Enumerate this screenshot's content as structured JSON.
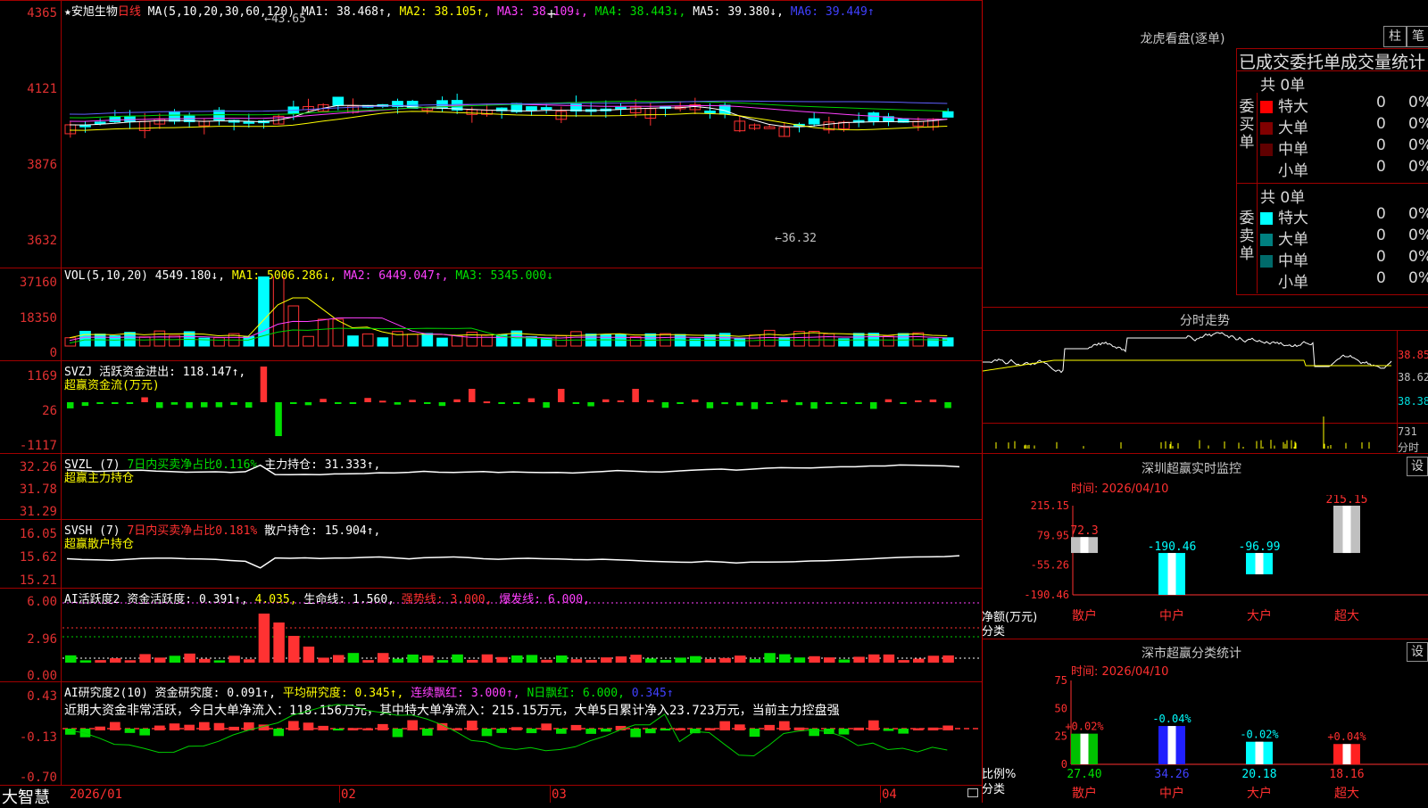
{
  "colors": {
    "up": "#ff3232",
    "down": "#00ffff",
    "grid": "#a00000",
    "ma1": "#ffffff",
    "ma2": "#ffff00",
    "ma3": "#ff40ff",
    "ma4": "#00d000",
    "ma5": "#8080ff"
  },
  "stock": {
    "name": "★安旭生物",
    "period": "日线"
  },
  "price_panel": {
    "ma_title": "MA(5,10,20,30,60,120)",
    "ma1": "MA1: 38.468↑,",
    "ma2": "MA2: 38.105↑,",
    "ma3": "MA3: 38.109↓,",
    "ma4": "MA4: 38.443↓,",
    "ma5": "MA5: 39.380↓,",
    "ma6": "MA6: 39.449↑",
    "y_ticks": [
      "4365",
      "4121",
      "3876",
      "3632"
    ],
    "high_label": "←43.65",
    "low_label": "←36.32",
    "cross": "+"
  },
  "vol_panel": {
    "title": "VOL(5,10,20)",
    "value": "4549.180↓,",
    "ma1": "MA1: 5006.286↓,",
    "ma2": "MA2: 6449.047↑,",
    "ma3": "MA3: 5345.000↓",
    "y_ticks": [
      "37160",
      "18350",
      "0"
    ]
  },
  "svzj_panel": {
    "title": "SVZJ  活跃资金进出: 118.147↑,",
    "sub": "超赢资金流(万元)",
    "y_ticks": [
      "1169",
      "26",
      "-1117"
    ]
  },
  "svzl_panel": {
    "title": "SVZL (7)",
    "ratio": "7日内买卖净占比0.116%",
    "hold": "主力持仓: 31.333↑,",
    "sub": "超赢主力持仓",
    "y_ticks": [
      "32.26",
      "31.78",
      "31.29"
    ]
  },
  "svsh_panel": {
    "title": "SVSH (7)",
    "ratio": "7日内买卖净占比0.181%",
    "hold": "散户持仓: 15.904↑,",
    "sub": "超赢散户持仓",
    "y_ticks": [
      "16.05",
      "15.62",
      "15.21"
    ]
  },
  "ai1_panel": {
    "title": "AI活跃度2 资金活跃度: 0.391↑,",
    "v2": "4.035,",
    "life": "生命线: 1.560,",
    "strong": "强势线: 3.000,",
    "burst": "爆发线: 6.000,",
    "y_ticks": [
      "6.00",
      "2.96",
      "0.00"
    ]
  },
  "ai2_panel": {
    "title": "AI研究度2(10) 资金研究度: 0.091↑,",
    "avg": "平均研究度: 0.345↑,",
    "lian": "连续飘红: 3.000↑,",
    "nday": "N日飘红: 6.000,",
    "tail": "0.345↑",
    "comment": "近期大资金非常活跃，今日大单净流入：118.156万元，其中特大单净流入：215.15万元，大单5日累计净入23.723万元，当前主力控盘强",
    "y_ticks": [
      "0.43",
      "-0.13",
      "-0.70"
    ]
  },
  "bottom": {
    "logo": "大智慧",
    "dates": [
      "2026/01",
      "02",
      "03",
      "04"
    ]
  },
  "lhb": {
    "title": "龙虎看盘(逐单)",
    "btn1": "柱",
    "btn2": "笔",
    "header": "已成交委托单成交量统计",
    "buy_label": "委买单",
    "sell_label": "委卖单",
    "buy_total": "共 0单",
    "sell_total": "共 0单",
    "buy_rows": [
      {
        "name": "特大",
        "count": "0",
        "pct": "0%",
        "color": "#ff0000"
      },
      {
        "name": "大单",
        "count": "0",
        "pct": "0%",
        "color": "#800000"
      },
      {
        "name": "中单",
        "count": "0",
        "pct": "0%",
        "color": "#600000"
      },
      {
        "name": "小单",
        "count": "0",
        "pct": "0%",
        "color": "#000000"
      }
    ],
    "sell_rows": [
      {
        "name": "特大",
        "count": "0",
        "pct": "0%",
        "color": "#00ffff"
      },
      {
        "name": "大单",
        "count": "0",
        "pct": "0%",
        "color": "#008080"
      },
      {
        "name": "中单",
        "count": "0",
        "pct": "0%",
        "color": "#006a6a"
      },
      {
        "name": "小单",
        "count": "0",
        "pct": "0%",
        "color": "#000000"
      }
    ]
  },
  "fenshi": {
    "title": "分时走势",
    "prices": [
      "38.85",
      "38.62",
      "38.38"
    ],
    "vol": "731",
    "vol_label": "分时"
  },
  "monitor": {
    "title": "深圳超赢实时监控",
    "btn": "设",
    "time": "时间: 2026/04/10",
    "y_ticks": [
      "215.15",
      "79.95",
      "-55.26",
      "-190.46"
    ],
    "axis_label1": "净额(万元)",
    "axis_label2": "分类",
    "bars": [
      {
        "cat": "散户",
        "value": 72.3,
        "label": "72.3"
      },
      {
        "cat": "中户",
        "value": -190.46,
        "label": "-190.46"
      },
      {
        "cat": "大户",
        "value": -96.99,
        "label": "-96.99"
      },
      {
        "cat": "超大",
        "value": 215.15,
        "label": "215.15"
      }
    ]
  },
  "classify": {
    "title": "深市超赢分类统计",
    "btn": "设",
    "time": "时间: 2026/04/10",
    "y_ticks": [
      "75",
      "50",
      "25",
      "0"
    ],
    "axis_label1": "比例%",
    "axis_label2": "分类",
    "bars": [
      {
        "cat": "散户",
        "value": 27.4,
        "label": "27.40",
        "delta": "+0.02%"
      },
      {
        "cat": "中户",
        "value": 34.26,
        "label": "34.26",
        "delta": "-0.04%"
      },
      {
        "cat": "大户",
        "value": 20.18,
        "label": "20.18",
        "delta": "-0.02%"
      },
      {
        "cat": "超大",
        "value": 18.16,
        "label": "18.16",
        "delta": "+0.04%"
      }
    ]
  },
  "chart_data": [
    {
      "type": "bar",
      "title": "深圳超赢实时监控",
      "categories": [
        "散户",
        "中户",
        "大户",
        "超大"
      ],
      "values": [
        72.3,
        -190.46,
        -96.99,
        215.15
      ],
      "ylabel": "净额(万元)",
      "ylim": [
        -190.46,
        215.15
      ]
    },
    {
      "type": "bar",
      "title": "深市超赢分类统计",
      "categories": [
        "散户",
        "中户",
        "大户",
        "超大"
      ],
      "values": [
        27.4,
        34.26,
        20.18,
        18.16
      ],
      "ylabel": "比例%",
      "ylim": [
        0,
        75
      ]
    }
  ]
}
